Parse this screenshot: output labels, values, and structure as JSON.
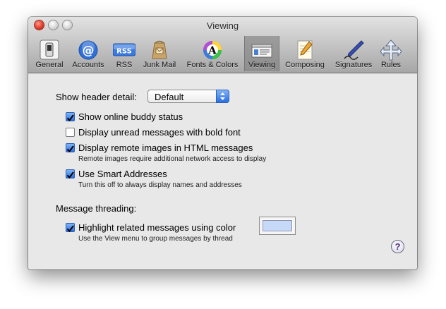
{
  "window": {
    "title": "Viewing"
  },
  "toolbar": {
    "items": [
      {
        "label": "General",
        "icon": "switch-icon"
      },
      {
        "label": "Accounts",
        "icon": "at-sign-icon"
      },
      {
        "label": "RSS",
        "icon": "rss-icon"
      },
      {
        "label": "Junk Mail",
        "icon": "junk-mail-bag-icon"
      },
      {
        "label": "Fonts & Colors",
        "icon": "fonts-colors-icon"
      },
      {
        "label": "Viewing",
        "icon": "viewing-icon",
        "selected": true
      },
      {
        "label": "Composing",
        "icon": "composing-pencil-icon"
      },
      {
        "label": "Signatures",
        "icon": "signature-pen-icon"
      },
      {
        "label": "Rules",
        "icon": "rules-icon"
      }
    ],
    "rss_badge": "RSS"
  },
  "viewing": {
    "header_detail_label": "Show header detail:",
    "header_detail_value": "Default",
    "show_buddy_status": {
      "label": "Show online buddy status",
      "checked": true
    },
    "bold_unread": {
      "label": "Display unread messages with bold font",
      "checked": false
    },
    "remote_images": {
      "label": "Display remote images in HTML messages",
      "checked": true,
      "note": "Remote images require additional network access to display"
    },
    "smart_addresses": {
      "label": "Use Smart Addresses",
      "checked": true,
      "note": "Turn this off to always display names and addresses"
    },
    "threading_label": "Message threading:",
    "highlight_related": {
      "label": "Highlight related messages using color",
      "checked": true,
      "note": "Use the View menu to group messages by thread"
    },
    "highlight_color": "#c6d9f8",
    "help_glyph": "?"
  },
  "colors": {
    "checkbox_blue": "#2c6fe0",
    "selected_tab": "#939393"
  }
}
